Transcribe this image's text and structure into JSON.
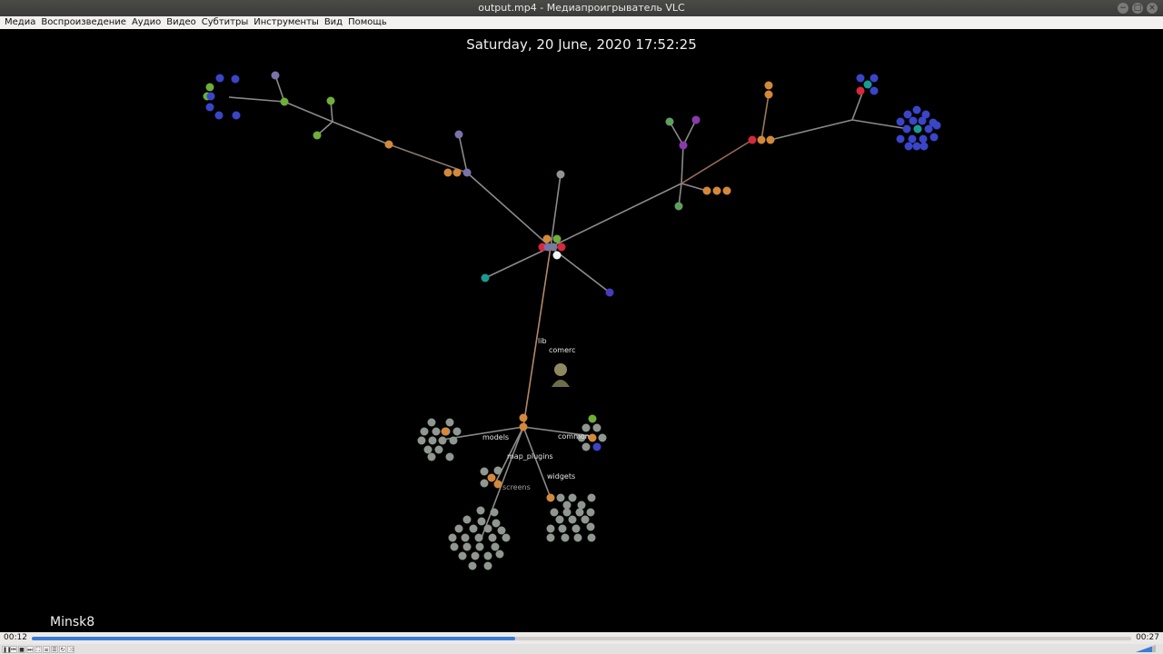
{
  "window": {
    "title": "output.mp4 - Медиапроигрыватель VLC",
    "buttons": [
      "−",
      "□",
      "×"
    ]
  },
  "menu": [
    "Медиа",
    "Воспроизведение",
    "Аудио",
    "Видео",
    "Субтитры",
    "Инструменты",
    "Вид",
    "Помощь"
  ],
  "video": {
    "datetime": "Saturday, 20 June, 2020 17:52:25",
    "caption": "Minsk8",
    "labels": {
      "lib": "lib",
      "user": "comerc",
      "models": "models",
      "common": "common",
      "map_plugins": "map_plugins",
      "widgets": "widgets",
      "screens": "screens"
    }
  },
  "player": {
    "elapsed": "00:12",
    "total": "00:27",
    "progress": 0.44,
    "controls": [
      "pause-icon",
      "previous-icon",
      "stop-icon",
      "next-icon",
      "fullscreen-icon",
      "extended-settings-icon",
      "playlist-icon",
      "loop-icon",
      "shuffle-icon"
    ],
    "colors": {
      "accent": "#3b7bd4"
    }
  }
}
